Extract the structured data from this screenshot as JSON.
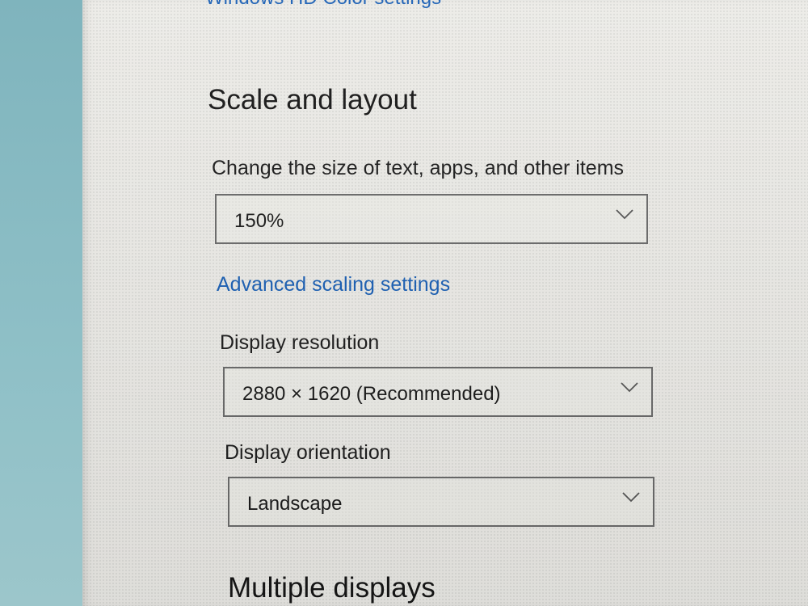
{
  "header": {
    "hdr_link": "Windows HD Color settings"
  },
  "scale_layout": {
    "title": "Scale and layout",
    "size_label": "Change the size of text, apps, and other items",
    "size_value": "150%",
    "advanced_link": "Advanced scaling settings",
    "resolution_label": "Display resolution",
    "resolution_value": "2880 × 1620 (Recommended)",
    "orientation_label": "Display orientation",
    "orientation_value": "Landscape"
  },
  "multiple_displays": {
    "title": "Multiple displays"
  },
  "icons": {
    "dropdown_arrow": "chevron-down-icon"
  },
  "colors": {
    "link": "#1a5fb4",
    "text": "#1a1a1a",
    "panel_bg": "#ecebe7",
    "desktop_bg": "#8fbcc4"
  }
}
